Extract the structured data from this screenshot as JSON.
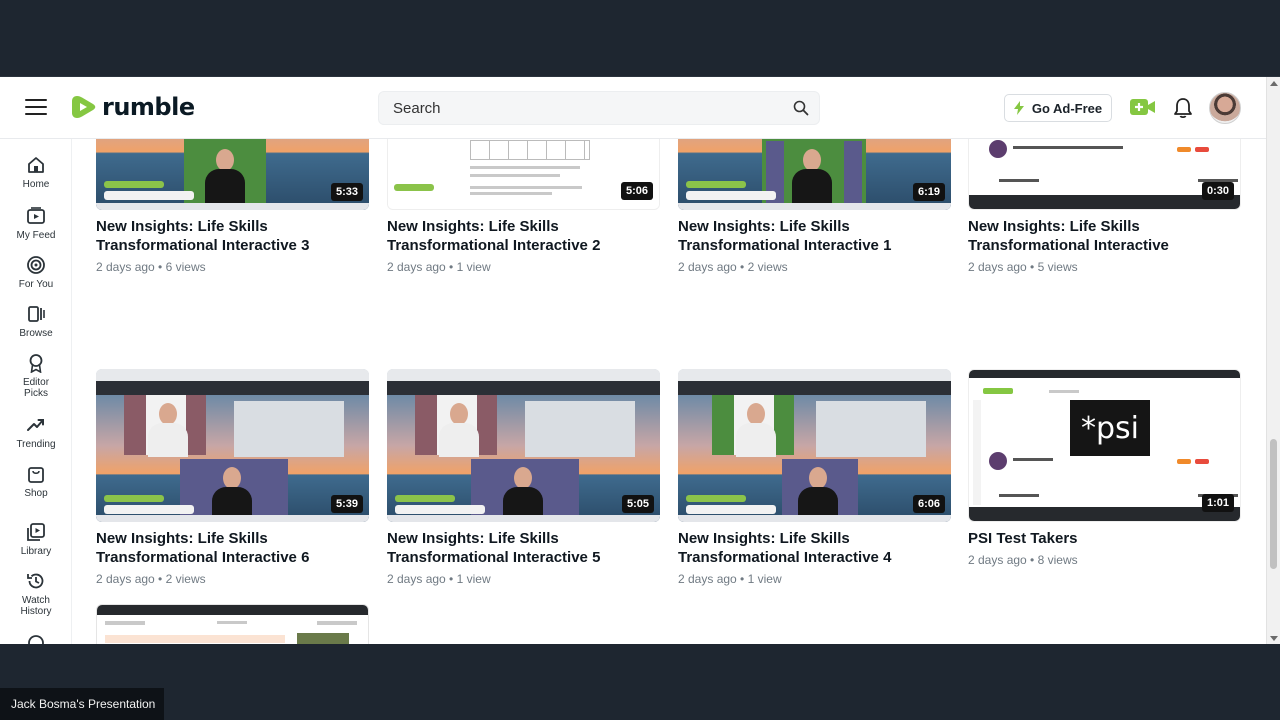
{
  "brand": {
    "name": "rumble",
    "accent": "#85c742"
  },
  "header": {
    "search_placeholder": "Search",
    "go_adfree_label": "Go Ad-Free"
  },
  "sidebar": {
    "items": [
      {
        "label": "Home",
        "icon": "home-icon"
      },
      {
        "label": "My Feed",
        "icon": "feed-icon"
      },
      {
        "label": "For You",
        "icon": "target-icon"
      },
      {
        "label": "Browse",
        "icon": "browse-icon"
      },
      {
        "label": "Editor\nPicks",
        "icon": "ribbon-icon"
      },
      {
        "label": "Trending",
        "icon": "trending-icon"
      },
      {
        "label": "Shop",
        "icon": "shop-icon"
      },
      {
        "label": "Library",
        "icon": "library-icon"
      },
      {
        "label": "Watch\nHistory",
        "icon": "history-icon"
      }
    ]
  },
  "videos": [
    {
      "title": "New Insights: Life Skills Transformational Interactive 3",
      "duration": "5:33",
      "age": "2 days ago",
      "views": "6",
      "views_label": "views"
    },
    {
      "title": "New Insights: Life Skills Transformational Interactive 2",
      "duration": "5:06",
      "age": "2 days ago",
      "views": "1",
      "views_label": "view"
    },
    {
      "title": "New Insights: Life Skills Transformational Interactive 1",
      "duration": "6:19",
      "age": "2 days ago",
      "views": "2",
      "views_label": "views"
    },
    {
      "title": "New Insights: Life Skills Transformational Interactive",
      "duration": "0:30",
      "age": "2 days ago",
      "views": "5",
      "views_label": "views"
    },
    {
      "title": "New Insights: Life Skills Transformational Interactive 6",
      "duration": "5:39",
      "age": "2 days ago",
      "views": "2",
      "views_label": "views"
    },
    {
      "title": "New Insights: Life Skills Transformational Interactive 5",
      "duration": "5:05",
      "age": "2 days ago",
      "views": "1",
      "views_label": "view"
    },
    {
      "title": "New Insights: Life Skills Transformational Interactive 4",
      "duration": "6:06",
      "age": "2 days ago",
      "views": "1",
      "views_label": "view"
    },
    {
      "title": "PSI Test Takers",
      "duration": "1:01",
      "age": "2 days ago",
      "views": "8",
      "views_label": "views"
    }
  ],
  "psi_thumb_text": "*psi",
  "presenter": {
    "label": "Jack Bosma's Presentation"
  }
}
